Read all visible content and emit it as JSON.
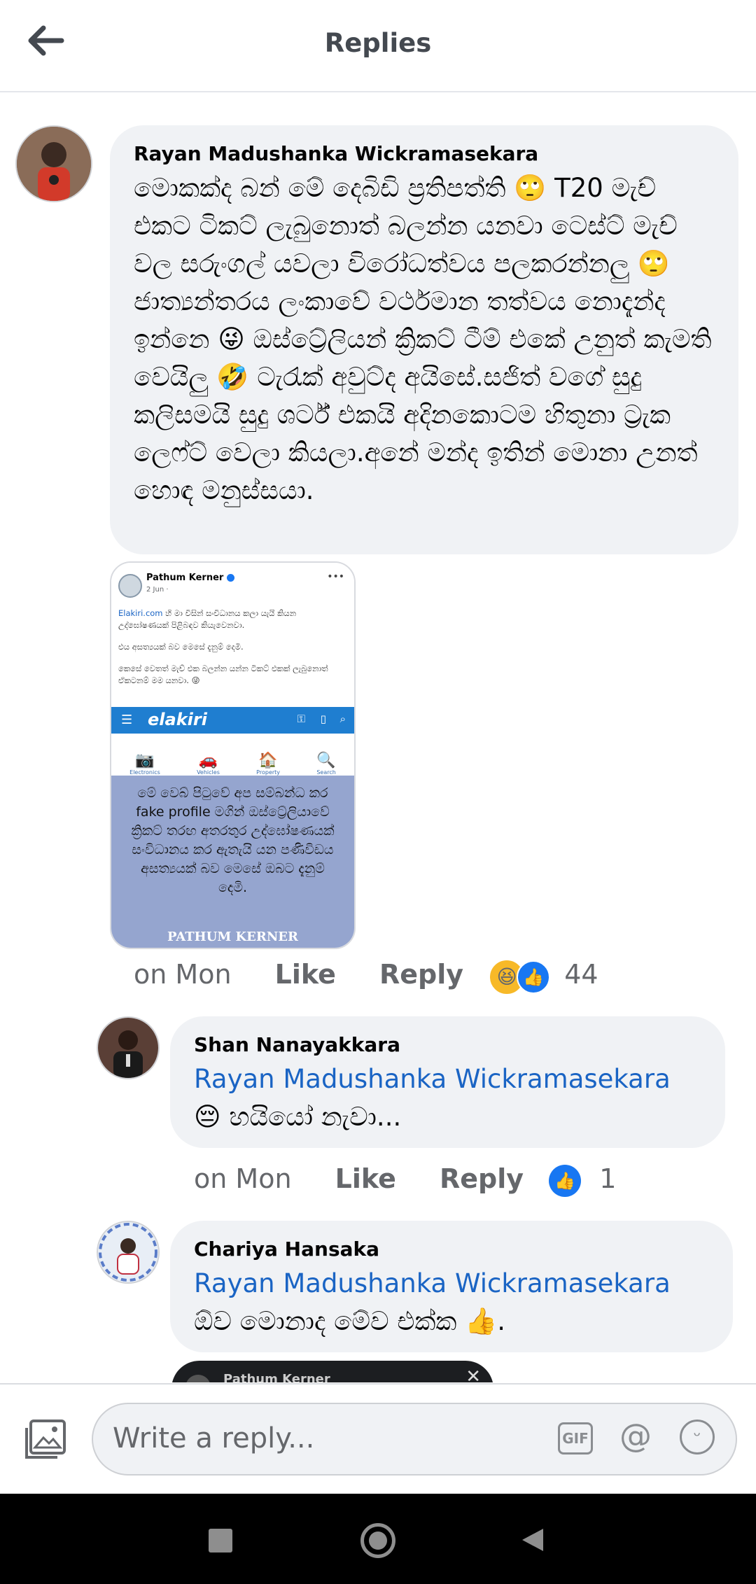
{
  "header": {
    "title": "Replies"
  },
  "main_comment": {
    "author": "Rayan Madushanka Wickramasekara",
    "text": "මොකක්ද බන් මේ දෙබිඩි ප්‍රතිපත්ති 🙄 T20 මැච් එකට ටිකට් ලැබුනොත් බලන්න යනවා ටෙස්ට් මැච් වල සරුංගල් යවලා විරෝධත්වය පලකරන්නලු 🙄 ජාත්‍යන්තරය ලංකාවේ වර්ථමාන තත්වය නොදැන්ද ඉන්නෙ 😜 ඔස්ට්‍රේලියන් ක්‍රිකට් ටීම් එකේ උනුත් කැමති වෙයිලු 🤣 ටැරැක් අවුට්ද අයිසේ.සජිත් වගේ සුදු කලිසමයි සුදු ශර්ට් එකයි අදිනකොටම හිතුනා ට්‍රැක ලෙෆ්ට් වෙලා කියලා.අනේ මන්ද ඉතින් මොනා උනත් හොඳ මනුස්සයා.",
    "time": "on Mon",
    "like_label": "Like",
    "reply_label": "Reply",
    "reaction_count": "44"
  },
  "attachment": {
    "post_author": "Pathum Kerner",
    "post_date": "2 Jun · ",
    "post_link": "Elakiri.com",
    "post_text_1": " හි මා විසින් සංවිධානය කලා යැයි කියන උද්ඝෝෂණයක් පිළිබඳව කියැවෙනවා.",
    "post_text_2": "එය අසත්‍යයක් බව මෙසේ දැනුම් දෙමි.",
    "post_text_3": "කෙසේ වෙතත් මැච් එක බලන්න යන්න ටිකට් එකක් ලැබුනොත් ඒකටනම් මම යනවා. 😜",
    "site_logo": "elakiri",
    "categories": [
      "Electronics",
      "Vehicles",
      "Property",
      "Search"
    ],
    "notice_text": "මේ වෙබ් පිටුවේ අප සම්බන්ධ කර fake profile මගින් ඔස්ට්‍රේලියාවේ ක්‍රිකට් තරඟ අතරතුර උද්ඝෝෂණයක් සංවිධානය කර ඇතැයි යන පණිවිඩය අසත්‍යයක් බව මෙසේ ඔබට දැනුම් දෙමි.",
    "footer_name": "PATHUM KERNER"
  },
  "replies": [
    {
      "author": "Shan Nanayakkara",
      "mention": "Rayan Madushanka Wickramasekara",
      "text": " 😔 හයියෝ නැවා...",
      "time": "on Mon",
      "like_label": "Like",
      "reply_label": "Reply",
      "reaction_count": "1"
    },
    {
      "author": "Chariya Hansaka",
      "mention": "Rayan Madushanka Wickramasekara",
      "text": " ඕව මොනාද මේව එක්ක 👍.",
      "partial_preview_author": "Pathum Kerner"
    }
  ],
  "composer": {
    "placeholder": "Write a reply...",
    "gif_label": "GIF"
  },
  "colors": {
    "mention": "#1a64c4",
    "like_blue": "#1877f2",
    "bubble": "#f0f2f5"
  }
}
